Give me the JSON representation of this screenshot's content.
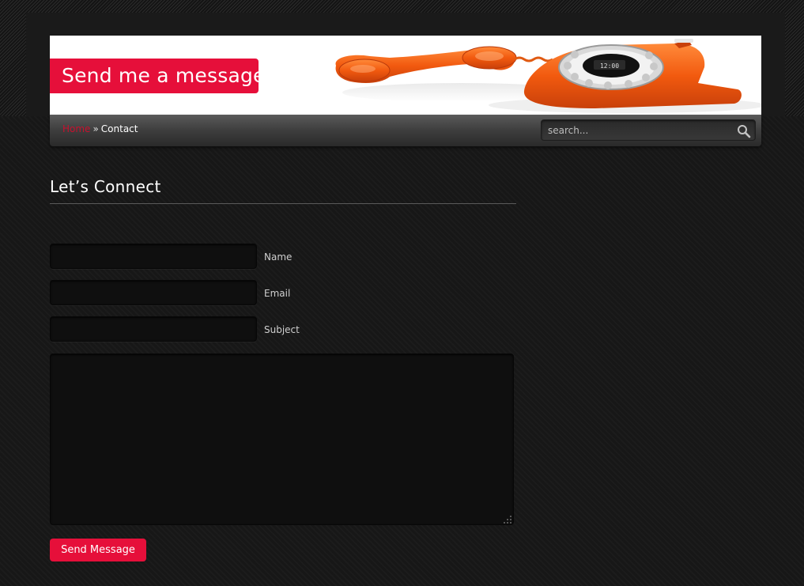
{
  "header": {
    "banner_title": "Send me a message",
    "banner_image": "orange-retro-telephone-icon"
  },
  "nav": {
    "breadcrumb": {
      "home_label": "Home",
      "separator": "»",
      "current_label": "Contact"
    },
    "search": {
      "placeholder": "search...",
      "icon": "magnifier-search-icon"
    }
  },
  "main": {
    "heading": "Let’s Connect",
    "form": {
      "name_label": "Name",
      "email_label": "Email",
      "subject_label": "Subject",
      "name_value": "",
      "email_value": "",
      "subject_value": "",
      "message_value": "",
      "submit_label": "Send Message"
    }
  },
  "colors": {
    "accent": "#e60f3a",
    "breadcrumb_link": "#c8102e",
    "page_background": "#171717",
    "field_background": "#0f0f0f"
  }
}
